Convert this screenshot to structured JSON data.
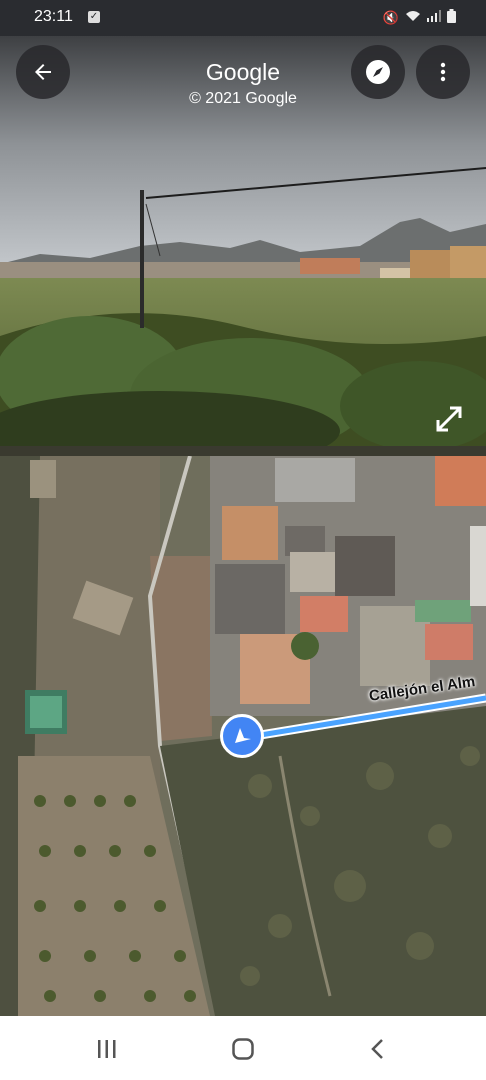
{
  "status_bar": {
    "time": "23:11"
  },
  "header": {
    "title": "Google",
    "subtitle": "© 2021 Google"
  },
  "icons": {
    "back": "arrow-back-icon",
    "compass": "compass-icon",
    "more": "more-vert-icon",
    "expand": "expand-icon",
    "location": "navigation-arrow-icon"
  },
  "map": {
    "street_label": "Callejón el Alm"
  },
  "colors": {
    "accent": "#4285f4",
    "route": "#4aa3ff",
    "overlay": "#28282c"
  }
}
